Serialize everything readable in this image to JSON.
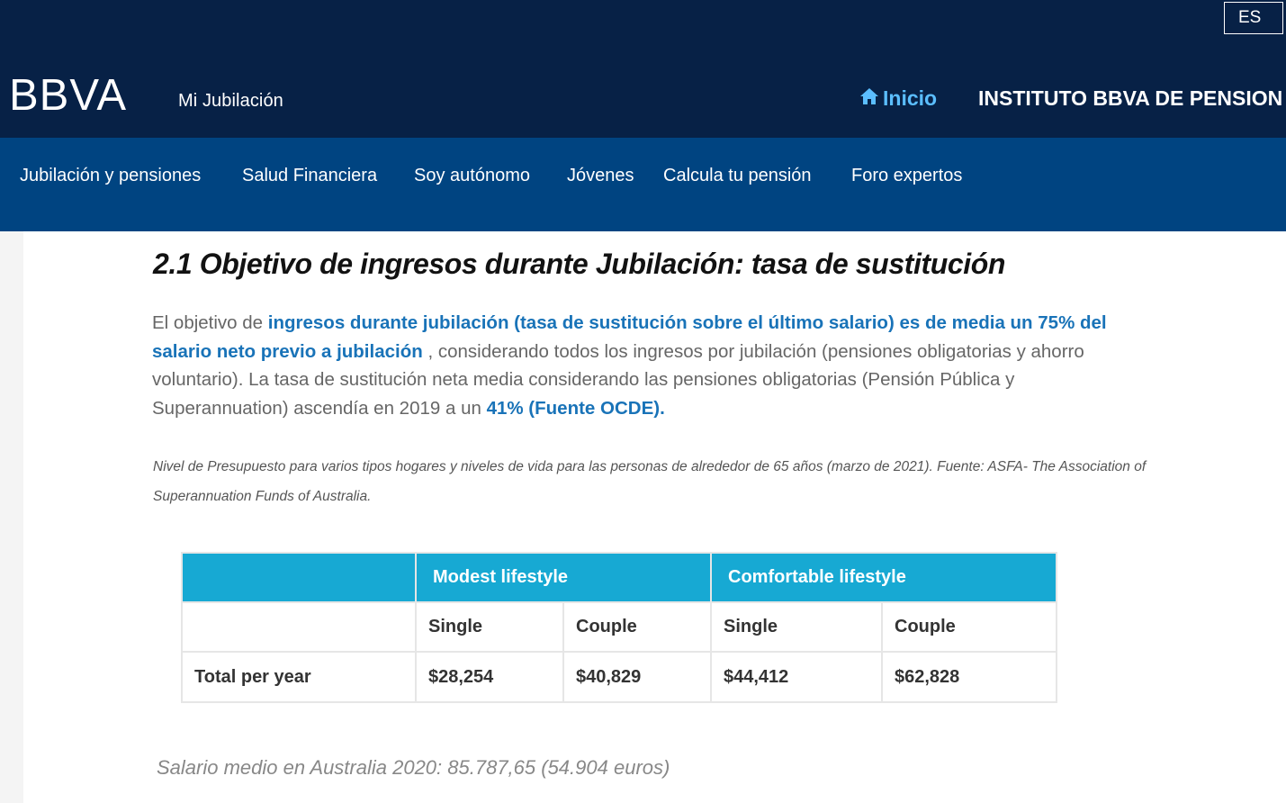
{
  "header": {
    "lang_button": "ES",
    "brand": "BBVA",
    "site_title": "Mi Jubilación",
    "home_link": "Inicio",
    "institute_link": "INSTITUTO BBVA DE PENSION"
  },
  "nav": {
    "items": [
      {
        "label": "Jubilación y pensiones"
      },
      {
        "label": "Salud Financiera"
      },
      {
        "label": "Soy autónomo"
      },
      {
        "label": "Jóvenes"
      },
      {
        "label": "Calcula tu pensión"
      },
      {
        "label": "Foro expertos"
      }
    ]
  },
  "article": {
    "heading": "2.1 Objetivo de ingresos durante Jubilación: tasa de sustitución",
    "para": {
      "t1": "El objetivo de ",
      "h1": "ingresos durante jubilación (tasa de sustitución sobre el último salario) es de media un 75% del salario neto previo a jubilación",
      "t2": " , considerando todos los ingresos por jubilación (pensiones obligatorias y ahorro voluntario). La tasa de sustitución neta media considerando las pensiones obligatorias (Pensión Pública y Superannuation) ascendía en 2019 a un ",
      "h2": "41% (Fuente OCDE)."
    },
    "caption": "Nivel de Presupuesto para varios tipos hogares y niveles de vida para las personas de alrededor de 65 años (marzo de 2021). Fuente: ASFA- The Association of Superannuation Funds of Australia.",
    "salary_note": "Salario medio en Australia 2020:  85.787,65 (54.904 euros)"
  },
  "table": {
    "groups": [
      "Modest lifestyle",
      "Comfortable lifestyle"
    ],
    "subheaders": [
      "Single",
      "Couple",
      "Single",
      "Couple"
    ],
    "row": {
      "label": "Total per year",
      "values": [
        "$28,254",
        "$40,829",
        "$44,412",
        "$62,828"
      ]
    }
  },
  "colors": {
    "header_bg": "#072146",
    "nav_bg": "#004481",
    "accent_link": "#5bbeff",
    "highlight_text": "#1973b8",
    "table_header": "#17a9d3"
  }
}
